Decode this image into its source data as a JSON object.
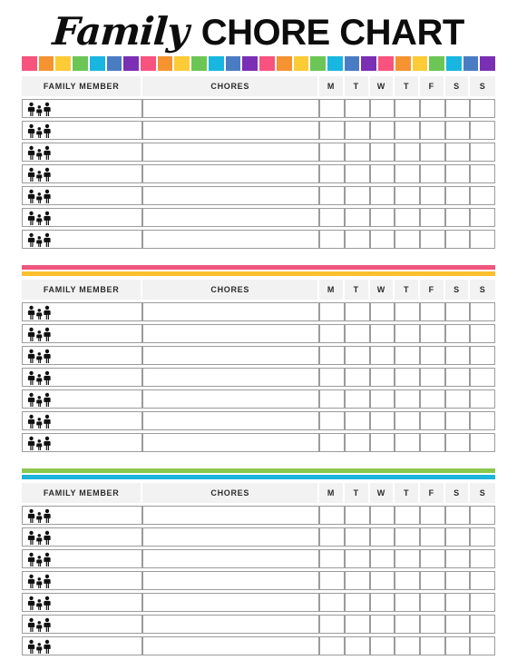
{
  "header": {
    "title_script": "Family",
    "title_block": "CHORE CHART"
  },
  "palette": {
    "pink": "#F8537E",
    "orange": "#F59331",
    "yellow": "#FCCB36",
    "green": "#6CC655",
    "cyan": "#18B6E0",
    "blue": "#4A7CC3",
    "purple": "#7A2FB5"
  },
  "rainbow": {
    "name": "rainbow-strip",
    "colors": [
      "#F8537E",
      "#F59331",
      "#FCCB36",
      "#6CC655",
      "#18B6E0",
      "#4A7CC3",
      "#7A2FB5",
      "#F8537E",
      "#F59331",
      "#FCCB36",
      "#6CC655",
      "#18B6E0",
      "#4A7CC3",
      "#7A2FB5",
      "#F8537E",
      "#F59331",
      "#FCCB36",
      "#6CC655",
      "#18B6E0",
      "#4A7CC3",
      "#7A2FB5",
      "#F8537E",
      "#F59331",
      "#FCCB36",
      "#6CC655",
      "#18B6E0",
      "#4A7CC3",
      "#7A2FB5"
    ]
  },
  "table": {
    "columns": {
      "member": "FAMILY MEMBER",
      "chores": "CHORES"
    },
    "days": [
      "M",
      "T",
      "W",
      "T",
      "F",
      "S",
      "S"
    ],
    "rows_per_section": 7,
    "member_icon": "family-icon",
    "member_values": [
      "",
      "",
      "",
      "",
      "",
      "",
      ""
    ],
    "chore_values": [
      "",
      "",
      "",
      "",
      "",
      "",
      ""
    ],
    "checkbox_values": [
      [
        "",
        "",
        "",
        "",
        "",
        "",
        ""
      ],
      [
        "",
        "",
        "",
        "",
        "",
        "",
        ""
      ],
      [
        "",
        "",
        "",
        "",
        "",
        "",
        ""
      ],
      [
        "",
        "",
        "",
        "",
        "",
        "",
        ""
      ],
      [
        "",
        "",
        "",
        "",
        "",
        "",
        ""
      ],
      [
        "",
        "",
        "",
        "",
        "",
        "",
        ""
      ],
      [
        "",
        "",
        "",
        "",
        "",
        "",
        ""
      ]
    ]
  },
  "sections": [
    {
      "id": "section-1",
      "divider_bars": []
    },
    {
      "id": "section-2",
      "divider_bars": [
        "#F0567E",
        "#FBC02D"
      ]
    },
    {
      "id": "section-3",
      "divider_bars": [
        "#8BC94E",
        "#1BB4DC"
      ]
    }
  ]
}
